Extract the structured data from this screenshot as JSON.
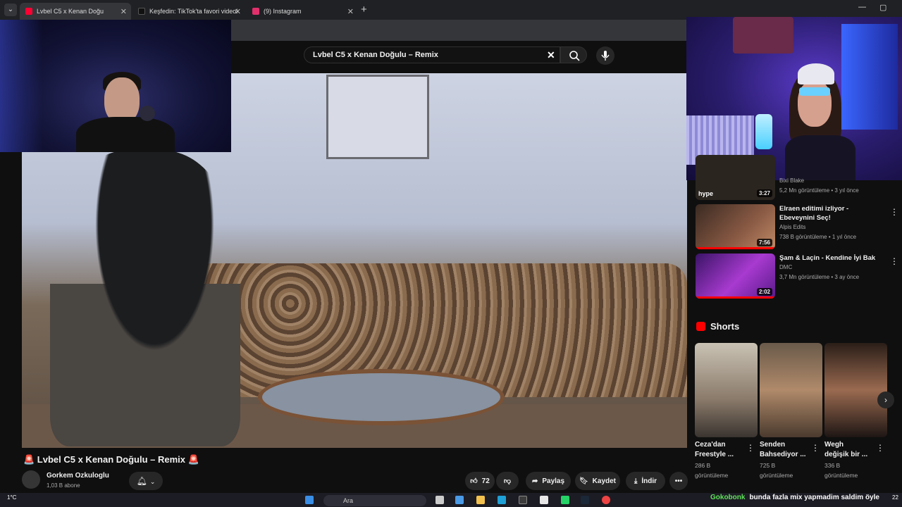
{
  "browser": {
    "tabs": [
      {
        "label": "Lvbel C5 x Kenan Doğu",
        "active": true,
        "favicon_color": "#ff0033"
      },
      {
        "label": "Keşfedin: TikTok'ta favori videol",
        "active": false,
        "favicon_color": "#111111"
      },
      {
        "label": "(9) Instagram",
        "active": false,
        "favicon_color": "#e1306c"
      }
    ],
    "new_tab_label": "+",
    "minimize_label": "—",
    "restore_label": "▢"
  },
  "search": {
    "query": "Lvbel C5 x Kenan Doğulu – Remix",
    "clear_label": "✕"
  },
  "video": {
    "title": "🚨 Lvbel C5 x Kenan Doğulu – Remix 🚨",
    "channel": "Gorkem Ozkuloglu",
    "subscribers": "1,03 B abone",
    "likes": "72",
    "share_label": "Paylaş",
    "save_label": "Kaydet",
    "download_label": "İndir",
    "more_label": "•••"
  },
  "recommendations": [
    {
      "title": "",
      "channel": "Bixi Blake",
      "meta": "5,2 Mn görüntüleme • 3 yıl önce",
      "duration": "3:27",
      "watched": false
    },
    {
      "title": "Elraen editimi izliyor - Ebeveynini Seç!",
      "channel": "Alpis Edits",
      "meta": "738 B görüntüleme • 1 yıl önce",
      "duration": "7:56",
      "watched": true
    },
    {
      "title": "Şam & Laçin - Kendine İyi Bak",
      "channel": "DMC",
      "meta": "3,7 Mn görüntüleme • 3 ay önce",
      "duration": "2:02",
      "watched": true
    }
  ],
  "shorts": {
    "label": "Shorts",
    "items": [
      {
        "title": "Ceza'dan\nFreestyle ...",
        "views": "286 B",
        "suffix": "görüntüleme"
      },
      {
        "title": "Senden\nBahsediyor ...",
        "views": "725 B",
        "suffix": "görüntüleme"
      },
      {
        "title": "Wegh\ndeğişik bir ...",
        "views": "336 B",
        "suffix": "görüntüleme"
      }
    ],
    "next_label": "›"
  },
  "taskbar": {
    "weather": "1°C",
    "search_placeholder": "Ara",
    "clock": "22"
  },
  "chat": {
    "user": "Gokobonk",
    "message": "bunda fazla mix yapmadim saldim öyle"
  },
  "colors": {
    "accent_red": "#ff0033",
    "background": "#0f0f0f",
    "chat_user": "#5fe35a"
  }
}
